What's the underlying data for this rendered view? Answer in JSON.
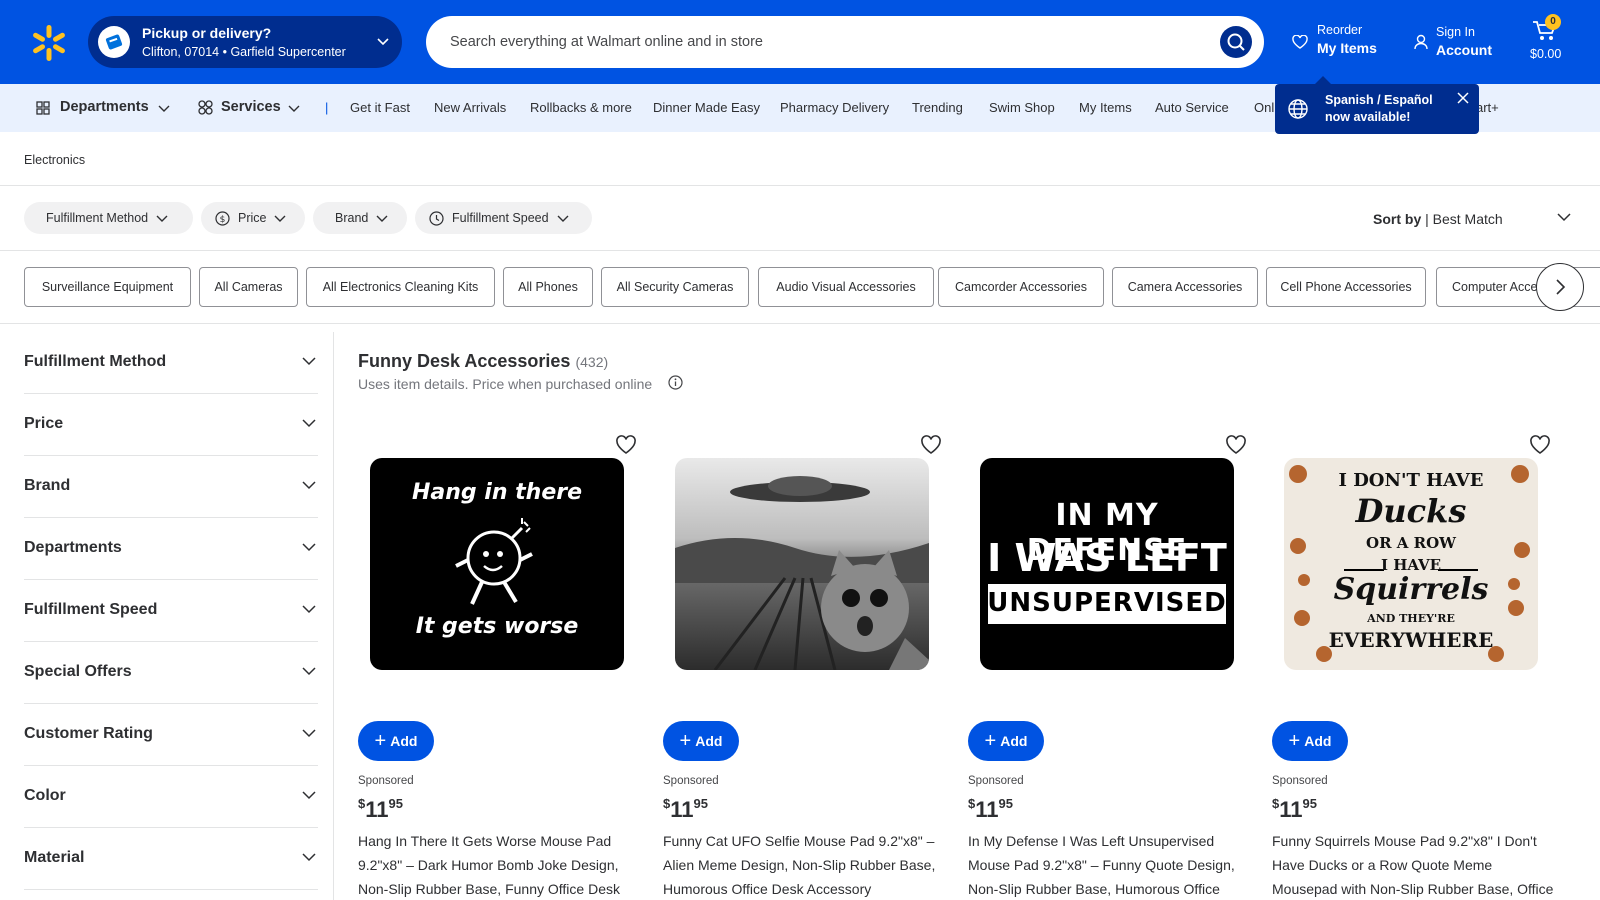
{
  "header": {
    "pickup_title": "Pickup or delivery?",
    "pickup_location": "Clifton, 07014 • Garfield Supercenter",
    "search_placeholder": "Search everything at Walmart online and in store",
    "reorder_top": "Reorder",
    "reorder_bottom": "My Items",
    "signin_top": "Sign In",
    "signin_bottom": "Account",
    "cart_count": "0",
    "cart_total": "$0.00",
    "brand_color": "#0053e2",
    "accent_color": "#ffc220"
  },
  "nav": {
    "departments": "Departments",
    "services": "Services",
    "separator": "|",
    "links": [
      "Get it Fast",
      "New Arrivals",
      "Rollbacks & more",
      "Dinner Made Easy",
      "Pharmacy Delivery",
      "Trending",
      "Swim Shop",
      "My Items",
      "Auto Service",
      "Onl"
    ],
    "trailing": "art+",
    "toast_message": "Spanish / Español now available!"
  },
  "breadcrumb": "Electronics",
  "filters": {
    "pills": [
      "Fulfillment Method",
      "Price",
      "Brand",
      "Fulfillment Speed"
    ],
    "sort_label": "Sort by",
    "sort_value": "| Best Match"
  },
  "categories": [
    "Surveillance Equipment",
    "All Cameras",
    "All Electronics Cleaning Kits",
    "All Phones",
    "All Security Cameras",
    "Audio Visual Accessories",
    "Camcorder Accessories",
    "Camera Accessories",
    "Cell Phone Accessories",
    "Computer Accessories"
  ],
  "sidebar": {
    "facets": [
      "Fulfillment Method",
      "Price",
      "Brand",
      "Departments",
      "Fulfillment Speed",
      "Special Offers",
      "Customer Rating",
      "Color",
      "Material"
    ]
  },
  "results": {
    "title": "Funny Desk Accessories",
    "count": "(432)",
    "subtitle": "Uses item details. Price when purchased online"
  },
  "products": [
    {
      "add_label": "Add",
      "sponsored": "Sponsored",
      "currency": "$",
      "dollars": "11",
      "cents": "95",
      "name": "Hang In There It Gets Worse Mouse Pad 9.2\"x8\" – Dark Humor Bomb Joke Design, Non-Slip Rubber Base, Funny Office Desk Accessory",
      "image_lines": [
        "Hang in there",
        "It gets worse"
      ]
    },
    {
      "add_label": "Add",
      "sponsored": "Sponsored",
      "currency": "$",
      "dollars": "11",
      "cents": "95",
      "name": "Funny Cat UFO Selfie Mouse Pad 9.2\"x8\" – Alien Meme Design, Non-Slip Rubber Base, Humorous Office Desk Accessory",
      "image_lines": []
    },
    {
      "add_label": "Add",
      "sponsored": "Sponsored",
      "currency": "$",
      "dollars": "11",
      "cents": "95",
      "name": "In My Defense I Was Left Unsupervised Mouse Pad 9.2\"x8\" – Funny Quote Design, Non-Slip Rubber Base, Humorous Office Desk Accessory",
      "image_lines": [
        "IN MY DEFENSE",
        "I WAS LEFT",
        "UNSUPERVISED"
      ]
    },
    {
      "add_label": "Add",
      "sponsored": "Sponsored",
      "currency": "$",
      "dollars": "11",
      "cents": "95",
      "name": "Funny Squirrels Mouse Pad 9.2\"x8\" I Don't Have Ducks or a Row Quote Meme Mousepad with Non-Slip Rubber Base, Office Desk Accessory",
      "image_lines": [
        "I DON'T HAVE",
        "Ducks",
        "OR A ROW",
        "I HAVE",
        "Squirrels",
        "AND THEY'RE",
        "EVERYWHERE"
      ]
    }
  ]
}
